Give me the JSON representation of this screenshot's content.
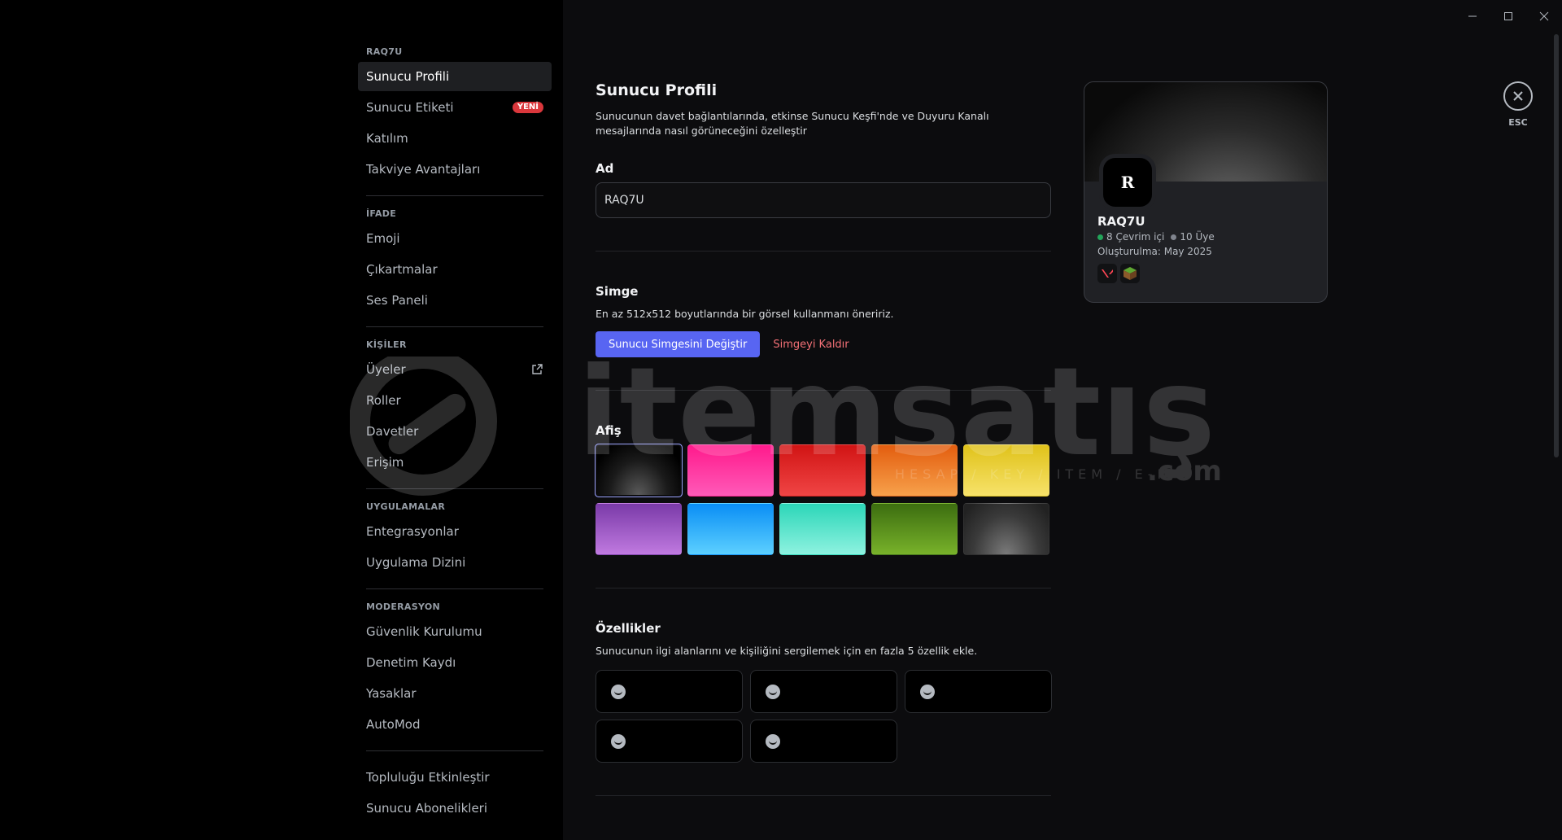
{
  "sidebar": {
    "sections": [
      {
        "header": "RAQ7U",
        "items": [
          {
            "label": "Sunucu Profili",
            "active": true
          },
          {
            "label": "Sunucu Etiketi",
            "badge": "YENİ"
          },
          {
            "label": "Katılım"
          },
          {
            "label": "Takviye Avantajları"
          }
        ]
      },
      {
        "header": "İFADE",
        "items": [
          {
            "label": "Emoji"
          },
          {
            "label": "Çıkartmalar"
          },
          {
            "label": "Ses Paneli"
          }
        ]
      },
      {
        "header": "KİŞİLER",
        "items": [
          {
            "label": "Üyeler",
            "icon": "external-link-icon"
          },
          {
            "label": "Roller"
          },
          {
            "label": "Davetler"
          },
          {
            "label": "Erişim"
          }
        ]
      },
      {
        "header": "UYGULAMALAR",
        "items": [
          {
            "label": "Entegrasyonlar"
          },
          {
            "label": "Uygulama Dizini"
          }
        ]
      },
      {
        "header": "MODERASYON",
        "items": [
          {
            "label": "Güvenlik Kurulumu"
          },
          {
            "label": "Denetim Kaydı"
          },
          {
            "label": "Yasaklar"
          },
          {
            "label": "AutoMod"
          }
        ]
      },
      {
        "header": "",
        "items": [
          {
            "label": "Topluluğu Etkinleştir"
          },
          {
            "label": "Sunucu Abonelikleri"
          }
        ]
      }
    ]
  },
  "page": {
    "title": "Sunucu Profili",
    "description": "Sunucunun davet bağlantılarında, etkinse Sunucu Keşfi'nde ve Duyuru Kanalı mesajlarında nasıl görüneceğini özelleştir",
    "name_label": "Ad",
    "name_value": "RAQ7U",
    "icon_label": "Simge",
    "icon_desc": "En az 512x512 boyutlarında bir görsel kullanmanı öneririz.",
    "icon_change_button": "Sunucu Simgesini Değiştir",
    "icon_remove_button": "Simgeyi Kaldır",
    "banner_label": "Afiş",
    "banners": [
      {
        "name": "black",
        "gradient": "radial-gradient(ellipse at 50% 100%, #5a5a5a 0%, #1a1a1a 50%, #000 85%)",
        "selected": true
      },
      {
        "name": "pink",
        "gradient": "linear-gradient(180deg, #ff1a8c, #ff5ab8)"
      },
      {
        "name": "red",
        "gradient": "linear-gradient(180deg, #d11414, #f04545)"
      },
      {
        "name": "orange",
        "gradient": "linear-gradient(180deg, #e35d0f, #f7a14b)"
      },
      {
        "name": "yellow",
        "gradient": "linear-gradient(180deg, #e0c21a, #f7e26a)"
      },
      {
        "name": "purple",
        "gradient": "linear-gradient(180deg, #7a3aa8, #c07ae0)"
      },
      {
        "name": "blue",
        "gradient": "linear-gradient(180deg, #0a8ef5, #5cd0ff)"
      },
      {
        "name": "teal",
        "gradient": "linear-gradient(180deg, #2cd6b8, #8ef2e0)"
      },
      {
        "name": "green",
        "gradient": "linear-gradient(180deg, #3c6d10, #78b22a)"
      },
      {
        "name": "gray",
        "gradient": "radial-gradient(ellipse at 50% 100%, #7a7a7a 0%, #3a3a3a 55%, #222 90%)"
      }
    ],
    "traits_label": "Özellikler",
    "traits_desc": "Sunucunun ilgi alanlarını ve kişiliğini sergilemek için en fazla 5 özellik ekle.",
    "traits_count": 5
  },
  "preview": {
    "icon_letter": "R",
    "name": "RAQ7U",
    "online": "8 Çevrim içi",
    "members": "10 Üye",
    "created": "Oluşturulma: May 2025",
    "online_color": "#23a55a",
    "members_color": "#80848e"
  },
  "esc": {
    "label": "ESC"
  },
  "watermark": {
    "brand": "itemsatış",
    "tagline": "HESAP / KEY / ITEM / E-PIN",
    "suffix": ".com"
  }
}
